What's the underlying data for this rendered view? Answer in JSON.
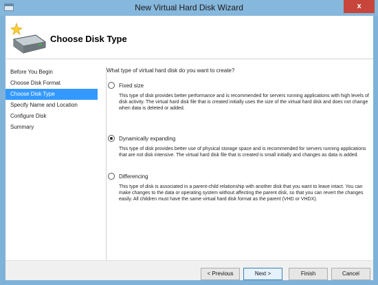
{
  "window": {
    "title": "New Virtual Hard Disk Wizard",
    "close_glyph": "x",
    "colors": {
      "chrome": "#86b7dc",
      "close": "#c7453a",
      "nav_active": "#3399ff"
    }
  },
  "header": {
    "title": "Choose Disk Type",
    "icon": "hard-disk-wizard-icon"
  },
  "sidebar": {
    "items": [
      {
        "label": "Before You Begin",
        "active": false
      },
      {
        "label": "Choose Disk Format",
        "active": false
      },
      {
        "label": "Choose Disk Type",
        "active": true
      },
      {
        "label": "Specify Name and Location",
        "active": false
      },
      {
        "label": "Configure Disk",
        "active": false
      },
      {
        "label": "Summary",
        "active": false
      }
    ]
  },
  "main": {
    "question": "What type of virtual hard disk do you want to create?",
    "options": [
      {
        "label": "Fixed size",
        "selected": false,
        "description": "This type of disk provides better performance and is recommended for servers running applications with high levels of disk activity. The virtual hard disk file that is created initially uses the size of the virtual hard disk and does not change when data is deleted or added."
      },
      {
        "label": "Dynamically expanding",
        "selected": true,
        "description": "This type of disk provides better use of physical storage space and is recommended for servers running applications that are not disk intensive. The virtual hard disk file that is created is small initially and changes as data is added."
      },
      {
        "label": "Differencing",
        "selected": false,
        "description": "This type of disk is associated in a parent-child relationship with another disk that you want to leave intact. You can make changes to the data or operating system without affecting the parent disk, so that you can revert the changes easily. All children must have the same virtual hard disk format as the parent (VHD or VHDX)."
      }
    ]
  },
  "footer": {
    "previous_label": "< Previous",
    "next_label": "Next >",
    "finish_label": "Finish",
    "cancel_label": "Cancel"
  }
}
